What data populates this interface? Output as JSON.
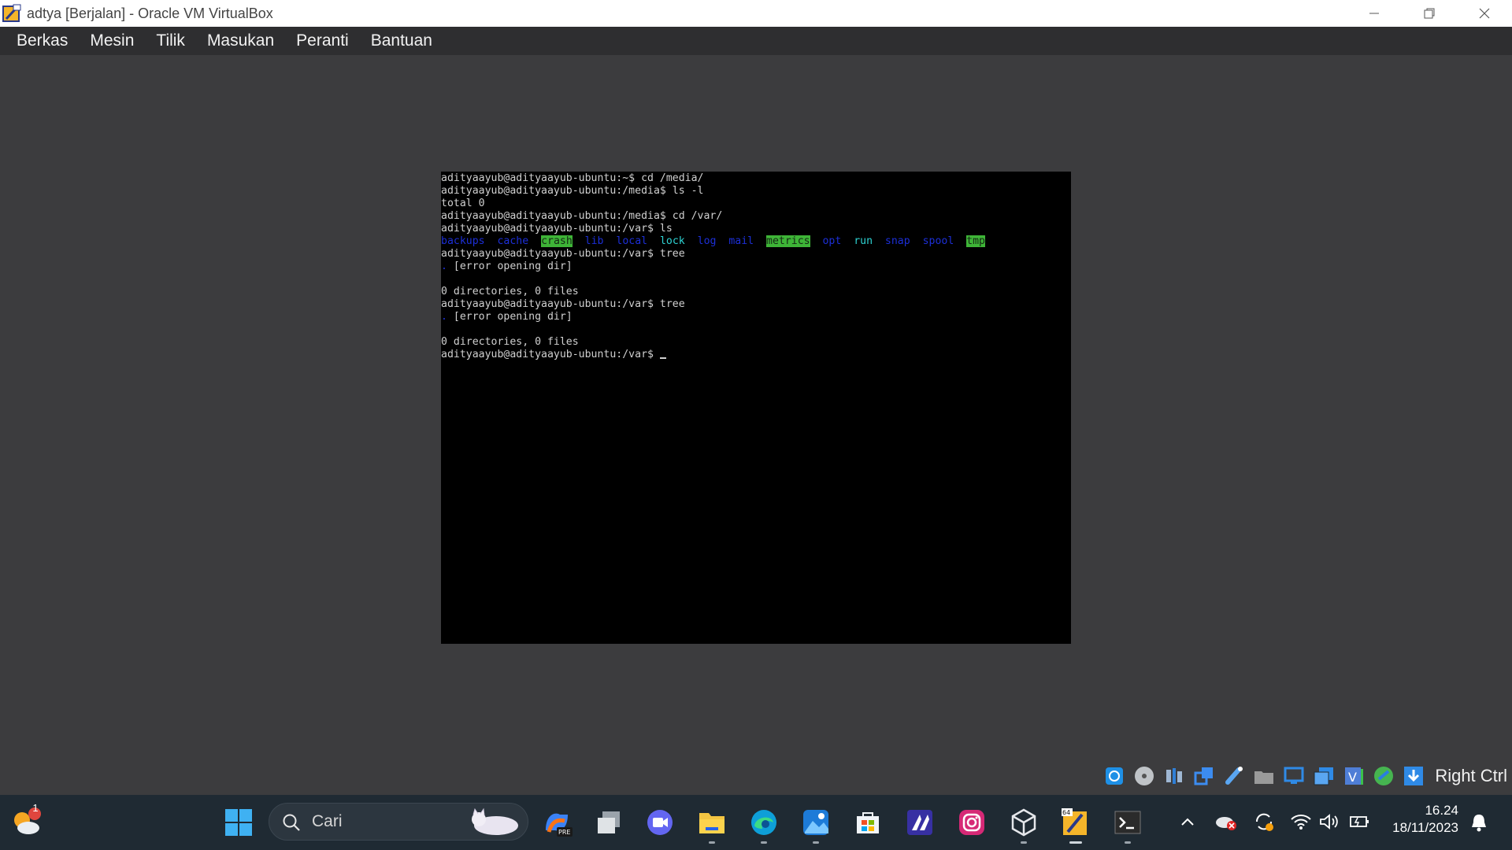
{
  "window": {
    "title": "adtya [Berjalan] - Oracle VM VirtualBox",
    "controls": [
      "minimize-icon",
      "restore-icon",
      "close-icon"
    ]
  },
  "menu": [
    "Berkas",
    "Mesin",
    "Tilik",
    "Masukan",
    "Peranti",
    "Bantuan"
  ],
  "terminal": {
    "lines": [
      [
        {
          "t": "adityaayub@adityaayub-ubuntu:~$ cd /media/",
          "c": "plain"
        }
      ],
      [
        {
          "t": "adityaayub@adityaayub-ubuntu:/media$ ls -l",
          "c": "plain"
        }
      ],
      [
        {
          "t": "total 0",
          "c": "plain"
        }
      ],
      [
        {
          "t": "adityaayub@adityaayub-ubuntu:/media$ cd /var/",
          "c": "plain"
        }
      ],
      [
        {
          "t": "adityaayub@adityaayub-ubuntu:/var$ ls",
          "c": "plain"
        }
      ],
      [
        {
          "t": "backups",
          "c": "blue"
        },
        {
          "t": "  ",
          "c": "plain"
        },
        {
          "t": "cache",
          "c": "blue"
        },
        {
          "t": "  ",
          "c": "plain"
        },
        {
          "t": "crash",
          "c": "hl"
        },
        {
          "t": "  ",
          "c": "plain"
        },
        {
          "t": "lib",
          "c": "blue"
        },
        {
          "t": "  ",
          "c": "plain"
        },
        {
          "t": "local",
          "c": "blue"
        },
        {
          "t": "  ",
          "c": "plain"
        },
        {
          "t": "lock",
          "c": "cyan"
        },
        {
          "t": "  ",
          "c": "plain"
        },
        {
          "t": "log",
          "c": "blue"
        },
        {
          "t": "  ",
          "c": "plain"
        },
        {
          "t": "mail",
          "c": "blue"
        },
        {
          "t": "  ",
          "c": "plain"
        },
        {
          "t": "metrics",
          "c": "hl"
        },
        {
          "t": "  ",
          "c": "plain"
        },
        {
          "t": "opt",
          "c": "blue"
        },
        {
          "t": "  ",
          "c": "plain"
        },
        {
          "t": "run",
          "c": "cyan"
        },
        {
          "t": "  ",
          "c": "plain"
        },
        {
          "t": "snap",
          "c": "blue"
        },
        {
          "t": "  ",
          "c": "plain"
        },
        {
          "t": "spool",
          "c": "blue"
        },
        {
          "t": "  ",
          "c": "plain"
        },
        {
          "t": "tmp",
          "c": "hl"
        }
      ],
      [
        {
          "t": "adityaayub@adityaayub-ubuntu:/var$ tree",
          "c": "plain"
        }
      ],
      [
        {
          "t": ".",
          "c": "blue"
        },
        {
          "t": " [error opening dir]",
          "c": "plain"
        }
      ],
      [
        {
          "t": "",
          "c": "plain"
        }
      ],
      [
        {
          "t": "0 directories, 0 files",
          "c": "plain"
        }
      ],
      [
        {
          "t": "adityaayub@adityaayub-ubuntu:/var$ tree",
          "c": "plain"
        }
      ],
      [
        {
          "t": ".",
          "c": "blue"
        },
        {
          "t": " [error opening dir]",
          "c": "plain"
        }
      ],
      [
        {
          "t": "",
          "c": "plain"
        }
      ],
      [
        {
          "t": "0 directories, 0 files",
          "c": "plain"
        }
      ],
      [
        {
          "t": "adityaayub@adityaayub-ubuntu:/var$ ",
          "c": "plain"
        }
      ]
    ],
    "colors": {
      "blue": "#1c2fd8",
      "cyan": "#2ed3d3",
      "highlight": "#3eb437",
      "text": "#d0d0d0"
    }
  },
  "statusbar": {
    "icons": [
      "hard-disk-icon",
      "optical-disk-icon",
      "audio-icon",
      "network-icon",
      "usb-icon",
      "shared-folders-icon",
      "display-icon",
      "recording-icon",
      "video-capture-icon",
      "guest-additions-icon",
      "keyboard-download-icon"
    ],
    "host_key": "Right Ctrl"
  },
  "taskbar": {
    "weather_badge": "1",
    "search_placeholder": "Cari",
    "apps": [
      "windows-start",
      "copilot",
      "task-view",
      "teams-meet",
      "file-explorer",
      "edge",
      "photos",
      "microsoft-store",
      "vscode-like",
      "instagram",
      "virtualbox",
      "virtualbox-vm",
      "terminal"
    ],
    "time": "16.24",
    "date": "18/11/2023"
  }
}
